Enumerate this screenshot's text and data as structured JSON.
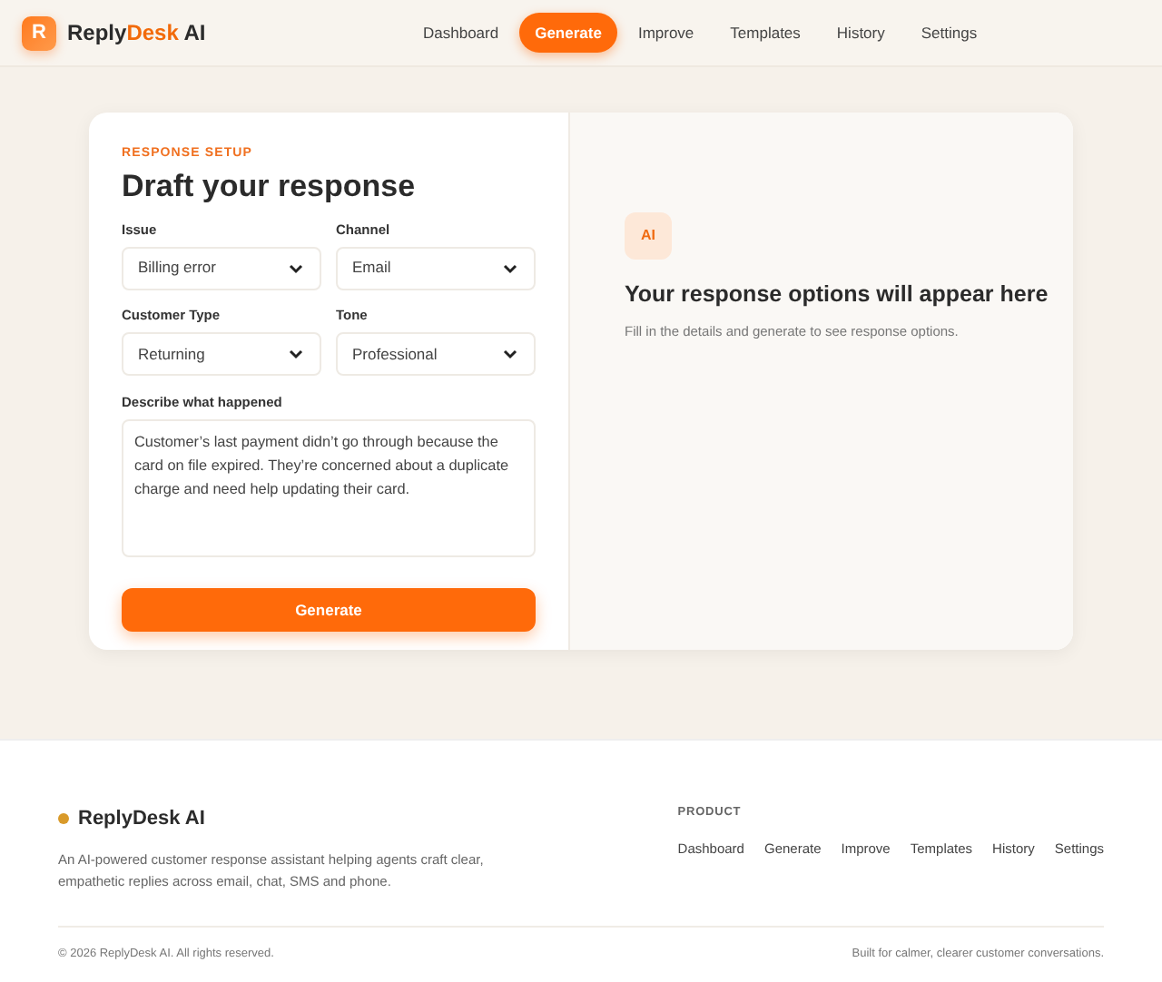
{
  "header": {
    "logo_letter": "R",
    "brand": [
      {
        "text": "Reply",
        "accent": false
      },
      {
        "text": "Desk",
        "accent": true
      },
      {
        "text": " AI",
        "accent": false
      }
    ],
    "nav": [
      {
        "label": "Dashboard",
        "selected": false
      },
      {
        "label": "Generate",
        "selected": true
      },
      {
        "label": "Improve",
        "selected": false
      },
      {
        "label": "Templates",
        "selected": false
      },
      {
        "label": "History",
        "selected": false
      },
      {
        "label": "Settings",
        "selected": false
      }
    ]
  },
  "form": {
    "eyebrow": "RESPONSE SETUP",
    "title": "Draft your response",
    "selects": [
      {
        "label": "Issue",
        "value": "Billing error"
      },
      {
        "label": "Channel",
        "value": "Email"
      },
      {
        "label": "Customer Type",
        "value": "Returning"
      },
      {
        "label": "Tone",
        "value": "Professional"
      }
    ],
    "description": {
      "label": "Describe what happened",
      "value": "Customer’s last payment didn’t go through because the card on file expired. They’re concerned about a duplicate charge and need help updating their card."
    },
    "button": "Generate"
  },
  "empty_state": {
    "badge": "AI",
    "title": "Your response options will appear here",
    "text": "Fill in the details and generate to see response options."
  },
  "footer": {
    "brand": "ReplyDesk AI",
    "blurb": "An AI-powered customer response assistant helping agents craft clear, empathetic replies across email, chat, SMS and phone.",
    "links_heading": "PRODUCT",
    "links": [
      "Dashboard",
      "Generate",
      "Improve",
      "Templates",
      "History",
      "Settings"
    ],
    "copyright": "© 2026 ReplyDesk AI. All rights reserved.",
    "tagline": "Built for calmer, clearer customer conversations."
  }
}
